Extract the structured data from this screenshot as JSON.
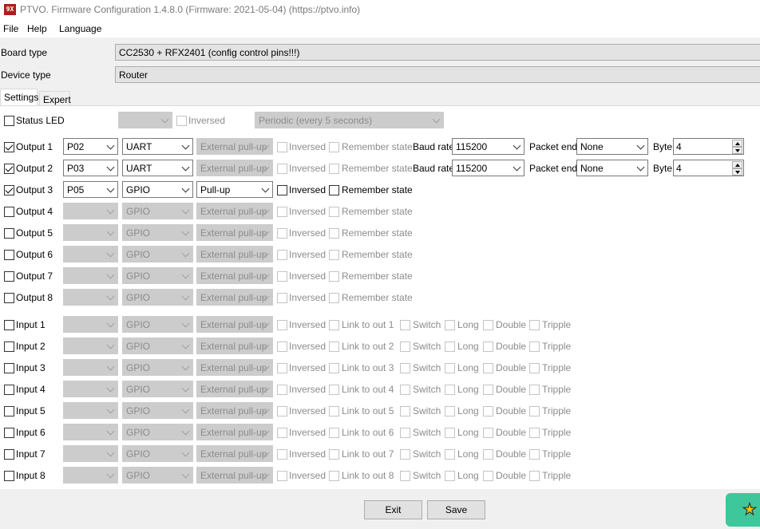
{
  "window": {
    "title": "PTVO. Firmware Configuration 1.4.8.0 (Firmware: 2021-05-04) (https://ptvo.info)",
    "icon_text": "9X"
  },
  "menu": [
    "File",
    "Help",
    "Language"
  ],
  "board": {
    "label": "Board type",
    "value": "CC2530 + RFX2401 (config control pins!!!)"
  },
  "device": {
    "label": "Device type",
    "value": "Router"
  },
  "tabs": [
    "Settings",
    "Expert"
  ],
  "status_led": {
    "label": "Status LED",
    "pin": "",
    "inversed": "Inversed",
    "mode": "Periodic (every 5 seconds)"
  },
  "outputs": [
    {
      "label": "Output 1",
      "checked": true,
      "pin": "P02",
      "type": "UART",
      "pull": "External pull-up",
      "enabled": true,
      "pull_enabled": false,
      "inversed": "Inversed",
      "remember": "Remember state",
      "uart": {
        "baud_label": "Baud rate",
        "baud": "115200",
        "packet_label": "Packet end",
        "packet": "None",
        "byte_label": "Byte",
        "byte": "4"
      }
    },
    {
      "label": "Output 2",
      "checked": true,
      "pin": "P03",
      "type": "UART",
      "pull": "External pull-up",
      "enabled": true,
      "pull_enabled": false,
      "inversed": "Inversed",
      "remember": "Remember state",
      "uart": {
        "baud_label": "Baud rate",
        "baud": "115200",
        "packet_label": "Packet end",
        "packet": "None",
        "byte_label": "Byte",
        "byte": "4"
      }
    },
    {
      "label": "Output 3",
      "checked": true,
      "pin": "P05",
      "type": "GPIO",
      "pull": "Pull-up",
      "enabled": true,
      "pull_enabled": true,
      "inversed": "Inversed",
      "remember": "Remember state"
    },
    {
      "label": "Output 4",
      "checked": false,
      "pin": "",
      "type": "GPIO",
      "pull": "External pull-up",
      "enabled": false,
      "inversed": "Inversed",
      "remember": "Remember state"
    },
    {
      "label": "Output 5",
      "checked": false,
      "pin": "",
      "type": "GPIO",
      "pull": "External pull-up",
      "enabled": false,
      "inversed": "Inversed",
      "remember": "Remember state"
    },
    {
      "label": "Output 6",
      "checked": false,
      "pin": "",
      "type": "GPIO",
      "pull": "External pull-up",
      "enabled": false,
      "inversed": "Inversed",
      "remember": "Remember state"
    },
    {
      "label": "Output 7",
      "checked": false,
      "pin": "",
      "type": "GPIO",
      "pull": "External pull-up",
      "enabled": false,
      "inversed": "Inversed",
      "remember": "Remember state"
    },
    {
      "label": "Output 8",
      "checked": false,
      "pin": "",
      "type": "GPIO",
      "pull": "External pull-up",
      "enabled": false,
      "inversed": "Inversed",
      "remember": "Remember state"
    }
  ],
  "inputs": [
    {
      "label": "Input 1",
      "pin": "",
      "type": "GPIO",
      "pull": "External pull-up",
      "inversed": "Inversed",
      "link": "Link to out 1",
      "switch": "Switch",
      "long": "Long",
      "double": "Double",
      "tripple": "Tripple"
    },
    {
      "label": "Input 2",
      "pin": "",
      "type": "GPIO",
      "pull": "External pull-up",
      "inversed": "Inversed",
      "link": "Link to out 2",
      "switch": "Switch",
      "long": "Long",
      "double": "Double",
      "tripple": "Tripple"
    },
    {
      "label": "Input 3",
      "pin": "",
      "type": "GPIO",
      "pull": "External pull-up",
      "inversed": "Inversed",
      "link": "Link to out 3",
      "switch": "Switch",
      "long": "Long",
      "double": "Double",
      "tripple": "Tripple"
    },
    {
      "label": "Input 4",
      "pin": "",
      "type": "GPIO",
      "pull": "External pull-up",
      "inversed": "Inversed",
      "link": "Link to out 4",
      "switch": "Switch",
      "long": "Long",
      "double": "Double",
      "tripple": "Tripple"
    },
    {
      "label": "Input 5",
      "pin": "",
      "type": "GPIO",
      "pull": "External pull-up",
      "inversed": "Inversed",
      "link": "Link to out 5",
      "switch": "Switch",
      "long": "Long",
      "double": "Double",
      "tripple": "Tripple"
    },
    {
      "label": "Input 6",
      "pin": "",
      "type": "GPIO",
      "pull": "External pull-up",
      "inversed": "Inversed",
      "link": "Link to out 6",
      "switch": "Switch",
      "long": "Long",
      "double": "Double",
      "tripple": "Tripple"
    },
    {
      "label": "Input 7",
      "pin": "",
      "type": "GPIO",
      "pull": "External pull-up",
      "inversed": "Inversed",
      "link": "Link to out 7",
      "switch": "Switch",
      "long": "Long",
      "double": "Double",
      "tripple": "Tripple"
    },
    {
      "label": "Input 8",
      "pin": "",
      "type": "GPIO",
      "pull": "External pull-up",
      "inversed": "Inversed",
      "link": "Link to out 8",
      "switch": "Switch",
      "long": "Long",
      "double": "Double",
      "tripple": "Tripple"
    }
  ],
  "buttons": {
    "exit": "Exit",
    "save": "Save"
  },
  "icons": {
    "star": "star-icon"
  }
}
